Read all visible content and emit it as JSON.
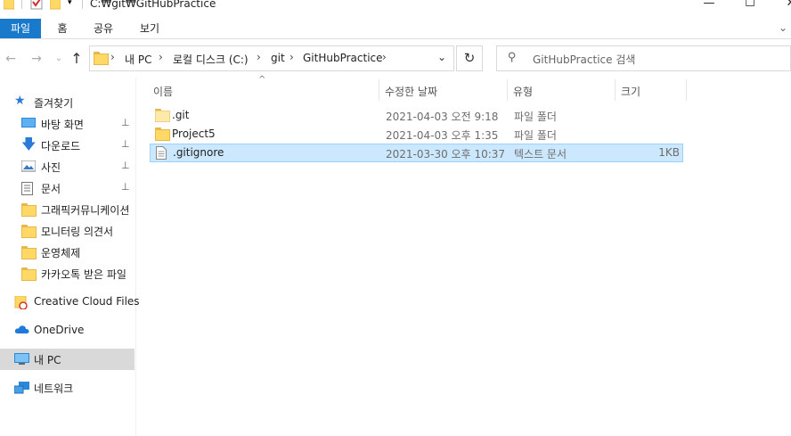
{
  "window": {
    "path_title": "C:₩git₩GitHubPractice",
    "min": "—",
    "max": "☐",
    "close": "✕"
  },
  "ribbon": {
    "tabs": [
      "파일",
      "홈",
      "공유",
      "보기"
    ],
    "expand": "⌄"
  },
  "nav": {
    "back": "←",
    "forward": "→",
    "recent": "⌄",
    "up": "↑",
    "refresh": "↻",
    "breadcrumb": [
      "내 PC",
      "로컬 디스크 (C:)",
      "git",
      "GitHubPractice"
    ],
    "separator": "›",
    "dropdown": "⌄",
    "search_placeholder": "GitHubPractice 검색",
    "search_icon": "⚲"
  },
  "sidebar": {
    "quick_access": "즐겨찾기",
    "pinned": [
      {
        "label": "바탕 화면",
        "icon": "desktop-icon"
      },
      {
        "label": "다운로드",
        "icon": "download-icon"
      },
      {
        "label": "사진",
        "icon": "pictures-icon"
      },
      {
        "label": "문서",
        "icon": "documents-icon"
      }
    ],
    "folders": [
      "그래픽커뮤니케이션",
      "모니터링 의견서",
      "운영체제",
      "카카오톡 받은 파일"
    ],
    "creative_cloud": "Creative Cloud Files",
    "onedrive": "OneDrive",
    "this_pc": "내 PC",
    "network": "네트워크",
    "pin_glyph": "📌"
  },
  "columns": {
    "name": "이름",
    "modified": "수정한 날짜",
    "type": "유형",
    "size": "크기",
    "sort_glyph": "^"
  },
  "files": [
    {
      "name": ".git",
      "modified": "2021-04-03 오전 9:18",
      "type": "파일 폴더",
      "size": "",
      "icon": "folder-icon"
    },
    {
      "name": "Project5",
      "modified": "2021-04-03 오후 1:35",
      "type": "파일 폴더",
      "size": "",
      "icon": "folder-icon"
    },
    {
      "name": ".gitignore",
      "modified": "2021-03-30 오후 10:37",
      "type": "텍스트 문서",
      "size": "1KB",
      "icon": "text-file-icon"
    }
  ],
  "colors": {
    "accent": "#1979ca",
    "selection_bg": "#cce8ff",
    "selection_border": "#99d1ff",
    "folder": "#ffd866"
  }
}
